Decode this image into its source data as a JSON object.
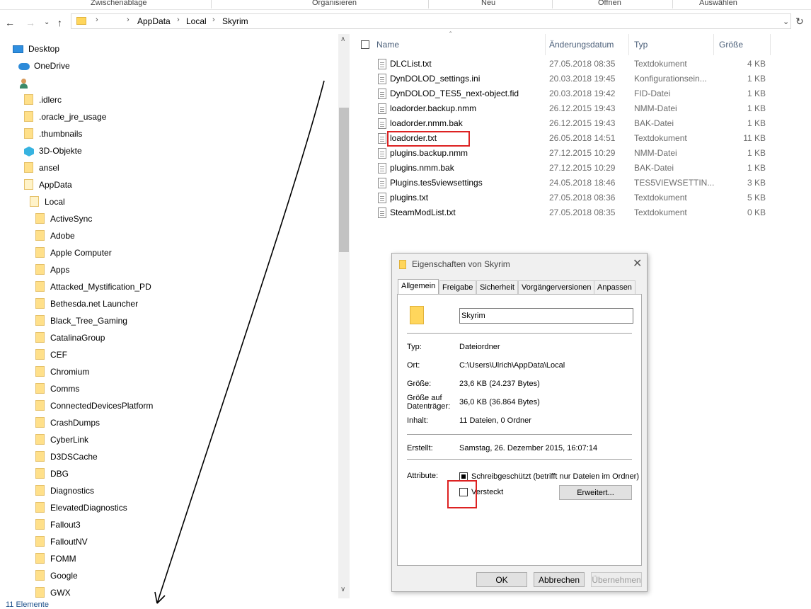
{
  "ribbon": {
    "groups": [
      "Zwischenablage",
      "Organisieren",
      "Neu",
      "Öffnen",
      "Auswählen"
    ]
  },
  "nav": {
    "back_icon": "back-arrow-icon",
    "forward_icon": "forward-arrow-icon",
    "history_icon": "chevron-down-icon",
    "up_icon": "up-arrow-icon"
  },
  "address": {
    "crumbs": [
      "AppData",
      "Local",
      "Skyrim"
    ],
    "separator": "›"
  },
  "tree": {
    "desktop": "Desktop",
    "onedrive": "OneDrive",
    "items": [
      ".idlerc",
      ".oracle_jre_usage",
      ".thumbnails",
      "3D-Objekte",
      "ansel",
      "AppData",
      "Local"
    ],
    "local_children": [
      "ActiveSync",
      "Adobe",
      "Apple Computer",
      "Apps",
      "Attacked_Mystification_PD",
      "Bethesda.net Launcher",
      "Black_Tree_Gaming",
      "CatalinaGroup",
      "CEF",
      "Chromium",
      "Comms",
      "ConnectedDevicesPlatform",
      "CrashDumps",
      "CyberLink",
      "D3DSCache",
      "DBG",
      "Diagnostics",
      "ElevatedDiagnostics",
      "Fallout3",
      "FalloutNV",
      "FOMM",
      "Google",
      "GWX"
    ]
  },
  "status": {
    "text": "11 Elemente"
  },
  "columns": {
    "name": "Name",
    "date": "Änderungsdatum",
    "type": "Typ",
    "size": "Größe"
  },
  "files": [
    {
      "name": "DLCList.txt",
      "date": "27.05.2018 08:35",
      "type": "Textdokument",
      "size": "4 KB"
    },
    {
      "name": "DynDOLOD_settings.ini",
      "date": "20.03.2018 19:45",
      "type": "Konfigurationsein...",
      "size": "1 KB"
    },
    {
      "name": "DynDOLOD_TES5_next-object.fid",
      "date": "20.03.2018 19:42",
      "type": "FID-Datei",
      "size": "1 KB"
    },
    {
      "name": "loadorder.backup.nmm",
      "date": "26.12.2015 19:43",
      "type": "NMM-Datei",
      "size": "1 KB"
    },
    {
      "name": "loadorder.nmm.bak",
      "date": "26.12.2015 19:43",
      "type": "BAK-Datei",
      "size": "1 KB"
    },
    {
      "name": "loadorder.txt",
      "date": "26.05.2018 14:51",
      "type": "Textdokument",
      "size": "11 KB"
    },
    {
      "name": "plugins.backup.nmm",
      "date": "27.12.2015 10:29",
      "type": "NMM-Datei",
      "size": "1 KB"
    },
    {
      "name": "plugins.nmm.bak",
      "date": "27.12.2015 10:29",
      "type": "BAK-Datei",
      "size": "1 KB"
    },
    {
      "name": "Plugins.tes5viewsettings",
      "date": "24.05.2018 18:46",
      "type": "TES5VIEWSETTIN...",
      "size": "3 KB"
    },
    {
      "name": "plugins.txt",
      "date": "27.05.2018 08:36",
      "type": "Textdokument",
      "size": "5 KB"
    },
    {
      "name": "SteamModList.txt",
      "date": "27.05.2018 08:35",
      "type": "Textdokument",
      "size": "0 KB"
    }
  ],
  "dialog": {
    "title": "Eigenschaften von Skyrim",
    "tabs": [
      "Allgemein",
      "Freigabe",
      "Sicherheit",
      "Vorgängerversionen",
      "Anpassen"
    ],
    "folder_name": "Skyrim",
    "typ_label": "Typ:",
    "typ_value": "Dateiordner",
    "ort_label": "Ort:",
    "ort_value": "C:\\Users\\Ulrich\\AppData\\Local",
    "groesse_label": "Größe:",
    "groesse_value": "23,6 KB (24.237 Bytes)",
    "groesse_auf_label_1": "Größe auf",
    "groesse_auf_label_2": "Datenträger:",
    "groesse_auf_value": "36,0 KB (36.864 Bytes)",
    "inhalt_label": "Inhalt:",
    "inhalt_value": "11 Dateien, 0 Ordner",
    "erstellt_label": "Erstellt:",
    "erstellt_value": "Samstag, 26. Dezember 2015, 16:07:14",
    "attribute_label": "Attribute:",
    "readonly_label": "Schreibgeschützt (betrifft nur Dateien im Ordner)",
    "hidden_label": "Versteckt",
    "advanced_button": "Erweitert...",
    "ok": "OK",
    "cancel": "Abbrechen",
    "apply": "Übernehmen"
  },
  "colors": {
    "highlight_red": "#dd2222",
    "folder_yellow": "#ffd65c",
    "header_text": "#4c607a",
    "status_text": "#1b4f8a"
  }
}
